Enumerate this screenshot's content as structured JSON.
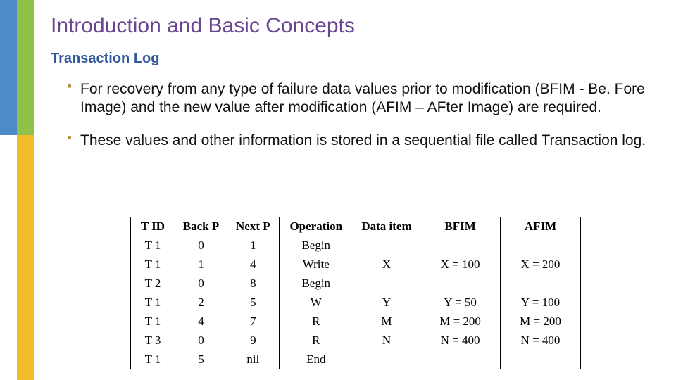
{
  "title": "Introduction and Basic Concepts",
  "subtitle": "Transaction Log",
  "bullets": [
    "For recovery from any type of failure data values prior to modification (BFIM - Be. Fore Image) and the new value after modification (AFIM – AFter Image) are required.",
    "These values and other information is stored in a sequential file called Transaction log."
  ],
  "table": {
    "headers": [
      "T ID",
      "Back P",
      "Next P",
      "Operation",
      "Data item",
      "BFIM",
      "AFIM"
    ],
    "rows": [
      [
        "T 1",
        "0",
        "1",
        "Begin",
        "",
        "",
        ""
      ],
      [
        "T 1",
        "1",
        "4",
        "Write",
        "X",
        "X = 100",
        "X = 200"
      ],
      [
        "T 2",
        "0",
        "8",
        "Begin",
        "",
        "",
        ""
      ],
      [
        "T 1",
        "2",
        "5",
        "W",
        "Y",
        "Y = 50",
        "Y = 100"
      ],
      [
        "T 1",
        "4",
        "7",
        "R",
        "M",
        "M = 200",
        "M = 200"
      ],
      [
        "T 3",
        "0",
        "9",
        "R",
        "N",
        "N = 400",
        "N = 400"
      ],
      [
        "T 1",
        "5",
        "nil",
        "End",
        "",
        "",
        ""
      ]
    ]
  },
  "chart_data": {
    "type": "table",
    "title": "Transaction Log",
    "columns": [
      "T ID",
      "Back P",
      "Next P",
      "Operation",
      "Data item",
      "BFIM",
      "AFIM"
    ],
    "rows": [
      {
        "T ID": "T 1",
        "Back P": 0,
        "Next P": 1,
        "Operation": "Begin",
        "Data item": "",
        "BFIM": "",
        "AFIM": ""
      },
      {
        "T ID": "T 1",
        "Back P": 1,
        "Next P": 4,
        "Operation": "Write",
        "Data item": "X",
        "BFIM": "X = 100",
        "AFIM": "X = 200"
      },
      {
        "T ID": "T 2",
        "Back P": 0,
        "Next P": 8,
        "Operation": "Begin",
        "Data item": "",
        "BFIM": "",
        "AFIM": ""
      },
      {
        "T ID": "T 1",
        "Back P": 2,
        "Next P": 5,
        "Operation": "W",
        "Data item": "Y",
        "BFIM": "Y = 50",
        "AFIM": "Y = 100"
      },
      {
        "T ID": "T 1",
        "Back P": 4,
        "Next P": 7,
        "Operation": "R",
        "Data item": "M",
        "BFIM": "M = 200",
        "AFIM": "M = 200"
      },
      {
        "T ID": "T 3",
        "Back P": 0,
        "Next P": 9,
        "Operation": "R",
        "Data item": "N",
        "BFIM": "N = 400",
        "AFIM": "N = 400"
      },
      {
        "T ID": "T 1",
        "Back P": 5,
        "Next P": "nil",
        "Operation": "End",
        "Data item": "",
        "BFIM": "",
        "AFIM": ""
      }
    ]
  }
}
